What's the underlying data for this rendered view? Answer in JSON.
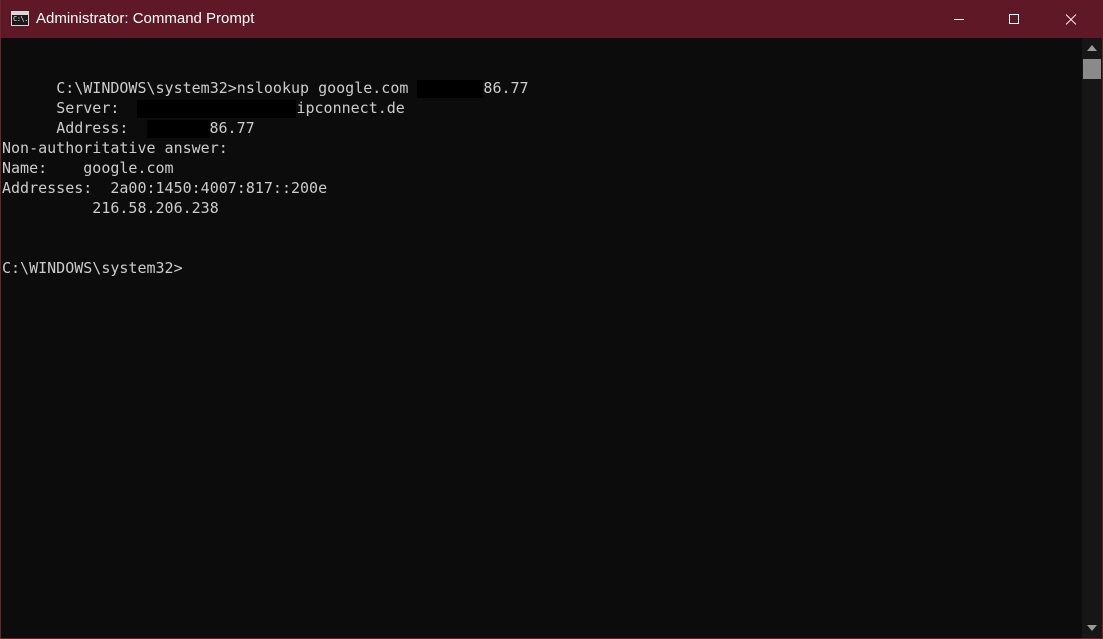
{
  "window": {
    "title": "Administrator: Command Prompt",
    "icon": "cmd-icon",
    "icon_text": "C:\\.",
    "accent_color": "#5e1826"
  },
  "titlebar_buttons": [
    "minimize",
    "maximize",
    "close"
  ],
  "console": {
    "text_color": "#cccccc",
    "background": "#0c0c0c",
    "lines": [
      {
        "text": "C:\\WINDOWS\\system32>nslookup google.com "
      },
      {
        "text": "86.77"
      },
      {
        "text": "Server:  "
      },
      {
        "text": "ipconnect.de"
      },
      {
        "text": "Address:  "
      },
      {
        "text": "86.77"
      },
      {
        "text": ""
      },
      {
        "text": "Non-authoritative answer:"
      },
      {
        "text": "Name:    google.com"
      },
      {
        "text": "Addresses:  2a00:1450:4007:817::200e"
      },
      {
        "text": "          216.58.206.238"
      },
      {
        "text": "C:\\WINDOWS\\system32>"
      }
    ]
  }
}
